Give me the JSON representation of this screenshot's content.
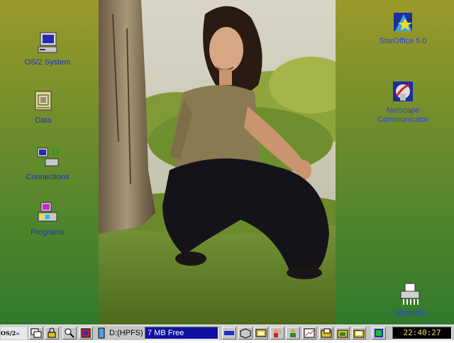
{
  "desktop": {
    "left_icons": [
      {
        "label": "OS/2 System",
        "icon": "computer-icon"
      },
      {
        "label": "Data",
        "icon": "data-folder-icon"
      },
      {
        "label": "Connections",
        "icon": "network-computer-icon"
      },
      {
        "label": "Programs",
        "icon": "programs-icon"
      }
    ],
    "right_icons": [
      {
        "label1": "StarOffice 5.0",
        "label2": "",
        "icon": "staroffice-icon"
      },
      {
        "label1": "Netscape",
        "label2": "Communicator",
        "icon": "netscape-icon"
      },
      {
        "label1": "Shredder",
        "label2": "",
        "icon": "shredder-icon"
      }
    ],
    "colors": {
      "icon_label": "#2030c0",
      "desktop_top": "#9a9a2a",
      "desktop_bottom": "#2f7a2c"
    }
  },
  "taskbar": {
    "logo_text": "OS/2",
    "drive_label": "D:(HPFS)",
    "free_space": "7 MB Free",
    "clock": "22:40:27",
    "colors": {
      "free_field": "#1010a0",
      "clock_text": "#e0e060"
    }
  }
}
